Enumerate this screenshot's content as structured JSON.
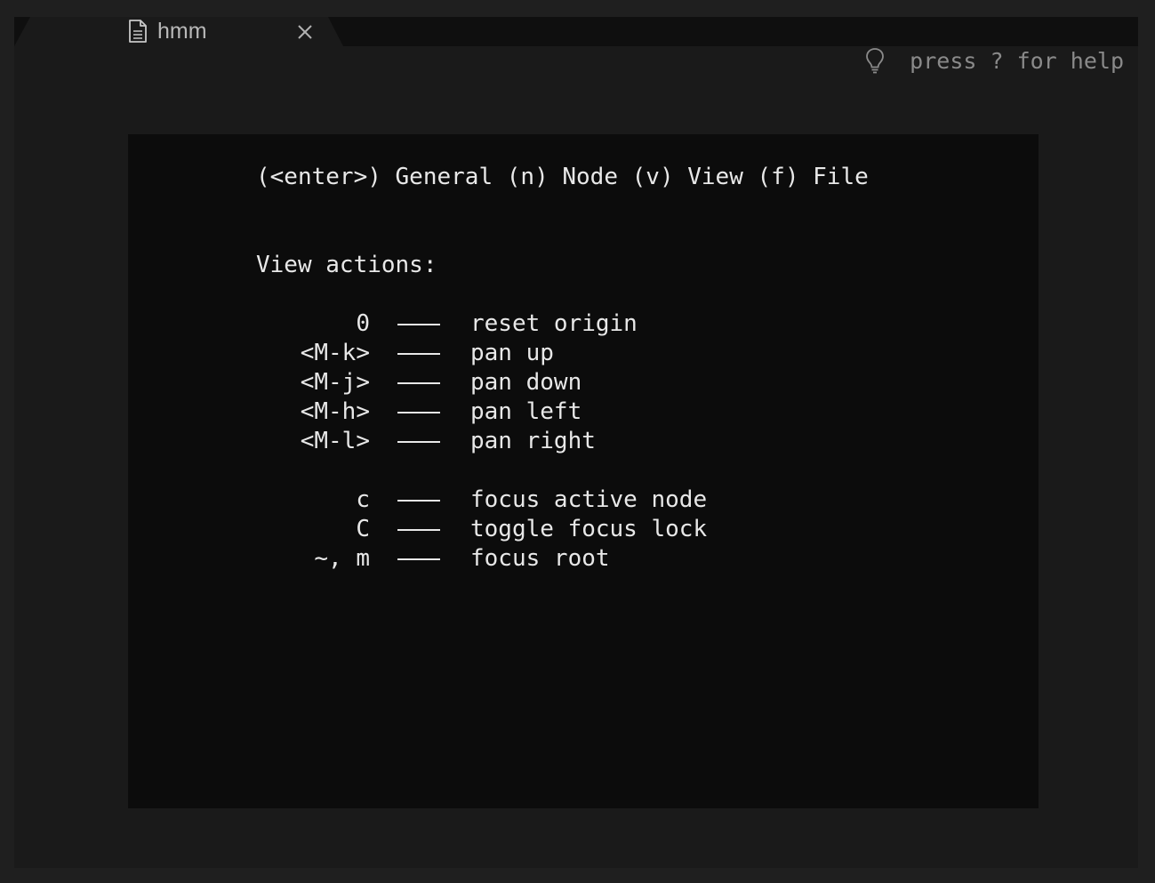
{
  "tab": {
    "title": "hmm",
    "icon": "document-icon",
    "close_icon": "close-icon"
  },
  "help_hint": {
    "icon": "lightbulb-icon",
    "text": "press ? for help"
  },
  "help": {
    "menu": "(<enter>) General (n) Node (v) View (f) File",
    "section_title": "View actions:",
    "bindings": [
      {
        "key": "0",
        "desc": "reset origin"
      },
      {
        "key": "<M-k>",
        "desc": "pan up"
      },
      {
        "key": "<M-j>",
        "desc": "pan down"
      },
      {
        "key": "<M-h>",
        "desc": "pan left"
      },
      {
        "key": "<M-l>",
        "desc": "pan right"
      },
      {
        "key": "c",
        "desc": "focus active node"
      },
      {
        "key": "C",
        "desc": "toggle focus lock"
      },
      {
        "key": "~, m",
        "desc": "focus root"
      }
    ]
  }
}
